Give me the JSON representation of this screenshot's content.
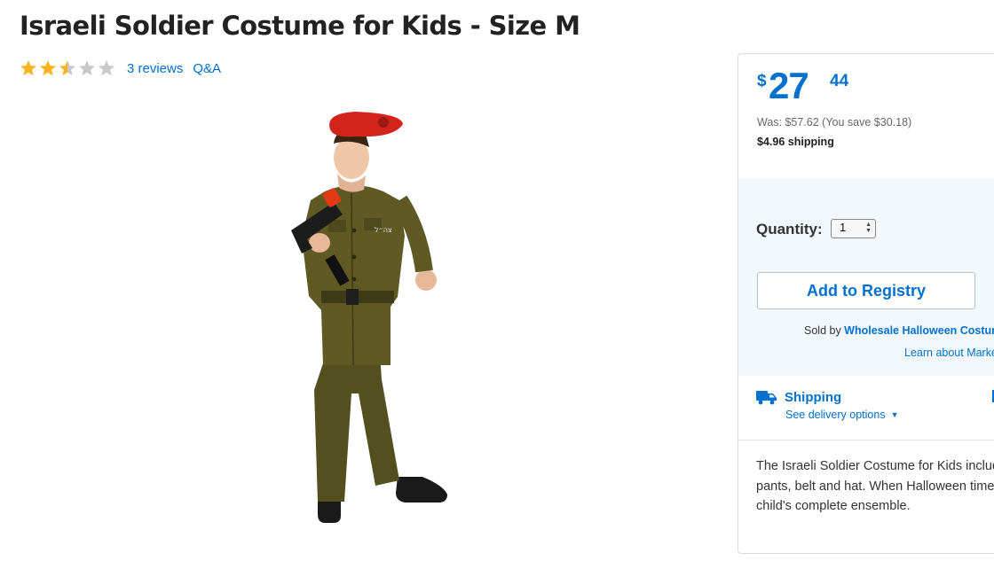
{
  "product": {
    "title": "Israeli Soldier Costume for Kids - Size M",
    "rating": 2.5,
    "rating_max": 5,
    "reviews_link": "3 reviews",
    "qa_link": "Q&A"
  },
  "buybox": {
    "price_currency": "$",
    "price_dollars": "27",
    "price_cents": "44",
    "was_price": "Was: $57.62  (You save $30.18)",
    "shipping_cost": "$4.96 shipping",
    "quantity_label": "Quantity:",
    "quantity_value": "1",
    "add_registry_label": "Add to Registry",
    "sold_by_prefix": "Sold by ",
    "seller_name": "Wholesale Halloween Costume",
    "learn_link": "Learn about Market",
    "shipping_title": "Shipping",
    "delivery_options": "See delivery options",
    "description_lines": [
      "The Israeli Soldier Costume for Kids includes",
      "pants, belt and hat. When Halloween time ro",
      "child's complete ensemble."
    ]
  },
  "colors": {
    "accent": "#0071ce",
    "star_filled": "#f8b31e",
    "star_empty": "#c8c8c8",
    "panel_bg": "#f2f8fd",
    "uniform": "#5f5a23",
    "beret": "#d3241c"
  },
  "icons": {
    "star": "star-icon",
    "truck": "truck-icon",
    "caret": "chevron-down-icon"
  }
}
